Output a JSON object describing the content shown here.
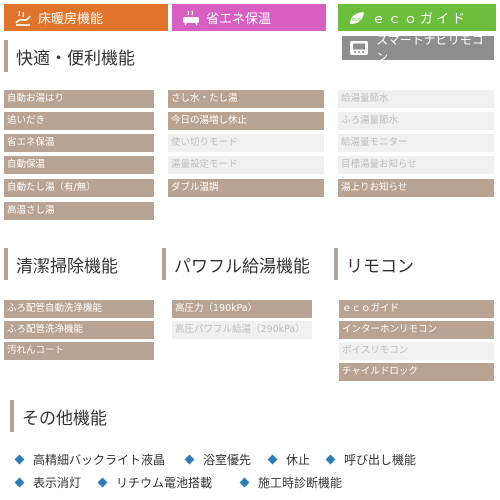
{
  "tabs": {
    "floor_heating": "床暖房機能",
    "energy_saving": "省エネ保温",
    "eco_guide": "ｅｃｏガイド",
    "eco_icon_text": "eco",
    "smart_remote": "スマートナビリモコン"
  },
  "colors": {
    "floor_heating": "#e0742c",
    "energy_saving": "#d85fc2",
    "eco_guide": "#6cbd3c",
    "smart_remote": "#8e8e8e",
    "item_active": "#b9a392",
    "item_inactive": "#f0f0f0",
    "bullet": "#2f7bb6"
  },
  "sections": {
    "convenience": {
      "title": "快適・便利機能",
      "col1": [
        {
          "label": "自動お湯はり",
          "active": true
        },
        {
          "label": "追いだき",
          "active": true
        },
        {
          "label": "省エネ保温",
          "active": true
        },
        {
          "label": "自動保温",
          "active": true
        },
        {
          "label": "自動たし湯（有/無）",
          "active": true
        },
        {
          "label": "高温さし湯",
          "active": true
        }
      ],
      "col2": [
        {
          "label": "さし水・たし湯",
          "active": true
        },
        {
          "label": "今日の湯増し休止",
          "active": true
        },
        {
          "label": "使い切りモード",
          "active": false
        },
        {
          "label": "湯量設定モード",
          "active": false
        },
        {
          "label": "ダブル温調",
          "active": true
        }
      ],
      "col3": [
        {
          "label": "給湯量節水",
          "active": false
        },
        {
          "label": "ふろ湯量節水",
          "active": false
        },
        {
          "label": "給湯量モニター",
          "active": false
        },
        {
          "label": "目標湯量お知らせ",
          "active": false
        },
        {
          "label": "湯上りお知らせ",
          "active": true
        }
      ]
    },
    "cleaning": {
      "title": "清潔掃除機能",
      "items": [
        {
          "label": "ふろ配管自動洗浄機能",
          "active": true
        },
        {
          "label": "ふろ配管洗浄機能",
          "active": true
        },
        {
          "label": "汚れんコート",
          "active": true
        }
      ]
    },
    "power": {
      "title": "パワフル給湯機能",
      "items": [
        {
          "label": "高圧力（190kPa）",
          "active": true
        },
        {
          "label": "高圧パワフル給湯（290kPa）",
          "active": false
        }
      ]
    },
    "remote": {
      "title": "リモコン",
      "items": [
        {
          "label": "ｅｃｏガイド",
          "active": true
        },
        {
          "label": "インターホンリモコン",
          "active": true
        },
        {
          "label": "ボイスリモコン",
          "active": false
        },
        {
          "label": "チャイルドロック",
          "active": true
        }
      ]
    },
    "other": {
      "title": "その他機能",
      "row1": [
        "高精細バックライト液晶",
        "浴室優先",
        "休止",
        "呼び出し機能"
      ],
      "row2": [
        "表示消灯",
        "リチウム電池搭載",
        "施工時診断機能"
      ]
    }
  }
}
